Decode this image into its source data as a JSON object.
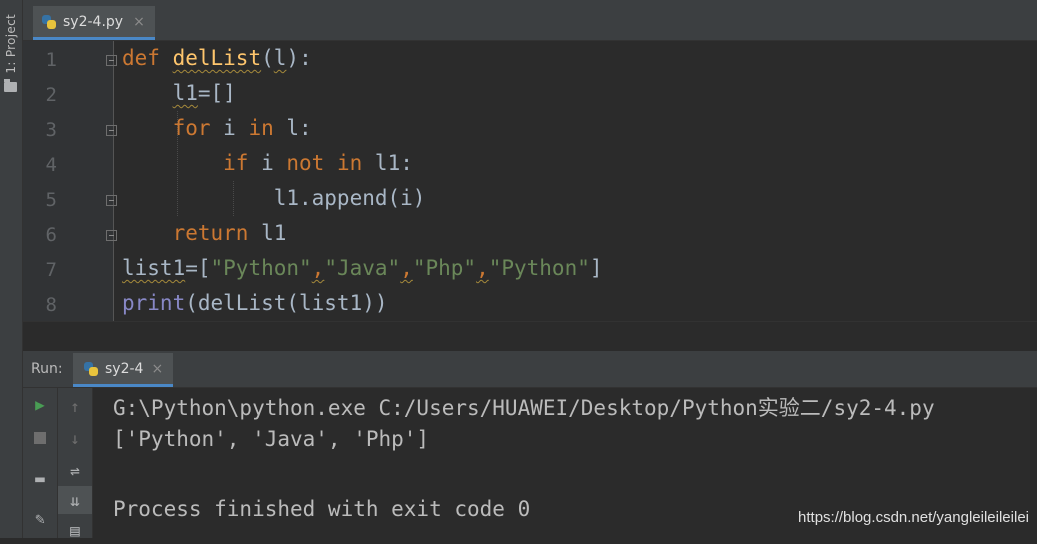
{
  "sidebar": {
    "project_label": "1: Project",
    "project_label_hotkey": "1",
    "project_label_rest": ": Project"
  },
  "editor": {
    "tab": {
      "filename": "sy2-4.py",
      "close": "×"
    },
    "line_numbers": [
      "1",
      "2",
      "3",
      "4",
      "5",
      "6",
      "7",
      "8"
    ]
  },
  "code": {
    "l1_def": "def",
    "l1_name": "delList",
    "l1_open": "(",
    "l1_param": "l",
    "l1_close": "):",
    "l2_var": "l1",
    "l2_rest": "=[]",
    "l3_for": "for",
    "l3_i": " i ",
    "l3_in": "in",
    "l3_rest": " l:",
    "l4_if": "if",
    "l4_i": " i ",
    "l4_not": "not",
    "l4_sp": " ",
    "l4_in": "in",
    "l4_rest": " l1:",
    "l5": "l1.append(i)",
    "l6_return": "return",
    "l6_rest": " l1",
    "l7_var": "list1",
    "l7_eq": "=[",
    "l7_s1": "\"Python\"",
    "l7_c1": ",",
    "l7_s2": "\"Java\"",
    "l7_c2": ",",
    "l7_s3": "\"Php\"",
    "l7_c3": ",",
    "l7_s4": "\"Python\"",
    "l7_end": "]",
    "l8_print": "print",
    "l8_rest": "(delList(list1))"
  },
  "run": {
    "label": "Run:",
    "tab_name": "sy2-4",
    "close": "×",
    "output": [
      "G:\\Python\\python.exe C:/Users/HUAWEI/Desktop/Python实验二/sy2-4.py",
      "['Python', 'Java', 'Php']",
      "",
      "Process finished with exit code 0"
    ]
  },
  "icons": [
    "python-file-icon",
    "folder-icon",
    "run-icon",
    "stop-icon",
    "up-arrow-icon",
    "down-arrow-icon",
    "soft-wrap-icon",
    "scroll-to-end-icon",
    "layout-icon",
    "pin-icon",
    "print-icon"
  ],
  "watermark": "https://blog.csdn.net/yangleileileilei"
}
